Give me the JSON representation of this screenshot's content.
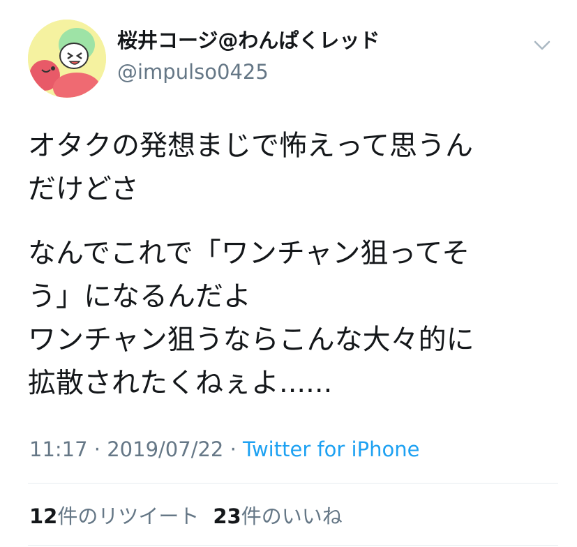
{
  "author": {
    "display_name": "桜井コージ@わんぱくレッド",
    "username": "@impulso0425"
  },
  "icons": {
    "avatar": "cartoon-avatar",
    "menu": "chevron-down-icon"
  },
  "tweet": {
    "paragraph_1": [
      "オタクの発想まじで怖えって思うん",
      "だけどさ"
    ],
    "paragraph_2": [
      "なんでこれで「ワンチャン狙ってそ",
      "う」になるんだよ",
      "ワンチャン狙うならこんな大々的に",
      "拡散されたくねぇよ......"
    ]
  },
  "meta": {
    "time": "11:17",
    "separator": "·",
    "date": "2019/07/22",
    "source": "Twitter for iPhone"
  },
  "stats": {
    "retweets_count": "12",
    "retweets_label": "件のリツイート",
    "likes_count": "23",
    "likes_label": "件のいいね"
  },
  "colors": {
    "link": "#1da1f2",
    "secondary_text": "#657786",
    "divider": "#e6ecf0"
  }
}
